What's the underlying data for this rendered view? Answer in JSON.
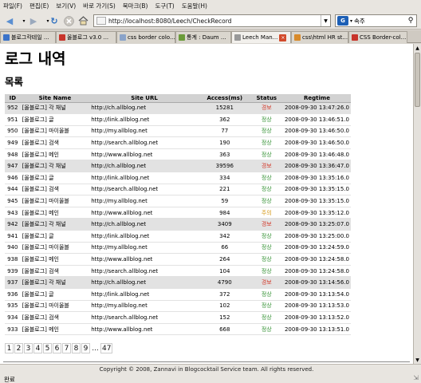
{
  "browser": {
    "menu": [
      "파일(F)",
      "편집(E)",
      "보기(V)",
      "바로 가기(S)",
      "북마크(B)",
      "도구(T)",
      "도움말(H)"
    ],
    "url": "http://localhost:8080/Leech/CheckRecord",
    "search_value": "속주",
    "status_text": "완료",
    "tabs": [
      {
        "label": "블로그칵테일 ...",
        "icon_color": "#3b73c9"
      },
      {
        "label": "올블로그 v3.0 ...",
        "icon_color": "#c8342b"
      },
      {
        "label": "css border colo...",
        "icon_color": "#8aa3c9"
      },
      {
        "label": "통계 : Daum ...",
        "icon_color": "#6a9b3a"
      },
      {
        "label": "Leech Man...",
        "icon_color": "#999999",
        "active": true
      },
      {
        "label": "css\\html HR st...",
        "icon_color": "#d88a2a"
      },
      {
        "label": "CSS Border-col...",
        "icon_color": "#c8342b"
      }
    ]
  },
  "page": {
    "title": "로그 내역",
    "section": "목록",
    "copyright": "Copyright © 2008, Zannavi in Blogcocktail Service team. All rights reserved."
  },
  "table": {
    "headers": [
      "ID",
      "Site Name",
      "Site URL",
      "Access(ms)",
      "Status",
      "Regtime"
    ],
    "rows": [
      {
        "id": "952",
        "name": "[올블로그] 각 채널",
        "url": "http://ch.allblog.net",
        "access": "15281",
        "status": "경보",
        "regtime": "2008-09-30 13:47:26.0"
      },
      {
        "id": "951",
        "name": "[올블로그] 글",
        "url": "http://link.allblog.net",
        "access": "362",
        "status": "정상",
        "regtime": "2008-09-30 13:46:51.0"
      },
      {
        "id": "950",
        "name": "[올블로그] 마이올블",
        "url": "http://my.allblog.net",
        "access": "77",
        "status": "정상",
        "regtime": "2008-09-30 13:46:50.0"
      },
      {
        "id": "949",
        "name": "[올블로그] 검색",
        "url": "http://search.allblog.net",
        "access": "190",
        "status": "정상",
        "regtime": "2008-09-30 13:46:50.0"
      },
      {
        "id": "948",
        "name": "[올블로그] 메인",
        "url": "http://www.allblog.net",
        "access": "363",
        "status": "정상",
        "regtime": "2008-09-30 13:46:48.0"
      },
      {
        "id": "947",
        "name": "[올블로그] 각 채널",
        "url": "http://ch.allblog.net",
        "access": "39596",
        "status": "경보",
        "regtime": "2008-09-30 13:36:47.0"
      },
      {
        "id": "946",
        "name": "[올블로그] 글",
        "url": "http://link.allblog.net",
        "access": "334",
        "status": "정상",
        "regtime": "2008-09-30 13:35:16.0"
      },
      {
        "id": "944",
        "name": "[올블로그] 검색",
        "url": "http://search.allblog.net",
        "access": "221",
        "status": "정상",
        "regtime": "2008-09-30 13:35:15.0"
      },
      {
        "id": "945",
        "name": "[올블로그] 마이올블",
        "url": "http://my.allblog.net",
        "access": "59",
        "status": "정상",
        "regtime": "2008-09-30 13:35:15.0"
      },
      {
        "id": "943",
        "name": "[올블로그] 메인",
        "url": "http://www.allblog.net",
        "access": "984",
        "status": "주의",
        "regtime": "2008-09-30 13:35:12.0"
      },
      {
        "id": "942",
        "name": "[올블로그] 각 채널",
        "url": "http://ch.allblog.net",
        "access": "3409",
        "status": "경보",
        "regtime": "2008-09-30 13:25:07.0"
      },
      {
        "id": "941",
        "name": "[올블로그] 글",
        "url": "http://link.allblog.net",
        "access": "342",
        "status": "정상",
        "regtime": "2008-09-30 13:25:00.0"
      },
      {
        "id": "940",
        "name": "[올블로그] 마이올블",
        "url": "http://my.allblog.net",
        "access": "66",
        "status": "정상",
        "regtime": "2008-09-30 13:24:59.0"
      },
      {
        "id": "938",
        "name": "[올블로그] 메인",
        "url": "http://www.allblog.net",
        "access": "264",
        "status": "정상",
        "regtime": "2008-09-30 13:24:58.0"
      },
      {
        "id": "939",
        "name": "[올블로그] 검색",
        "url": "http://search.allblog.net",
        "access": "104",
        "status": "정상",
        "regtime": "2008-09-30 13:24:58.0"
      },
      {
        "id": "937",
        "name": "[올블로그] 각 채널",
        "url": "http://ch.allblog.net",
        "access": "4790",
        "status": "경보",
        "regtime": "2008-09-30 13:14:56.0"
      },
      {
        "id": "936",
        "name": "[올블로그] 글",
        "url": "http://link.allblog.net",
        "access": "372",
        "status": "정상",
        "regtime": "2008-09-30 13:13:54.0"
      },
      {
        "id": "935",
        "name": "[올블로그] 마이올블",
        "url": "http://my.allblog.net",
        "access": "102",
        "status": "정상",
        "regtime": "2008-09-30 13:13:53.0"
      },
      {
        "id": "934",
        "name": "[올블로그] 검색",
        "url": "http://search.allblog.net",
        "access": "152",
        "status": "정상",
        "regtime": "2008-09-30 13:13:52.0"
      },
      {
        "id": "933",
        "name": "[올블로그] 메인",
        "url": "http://www.allblog.net",
        "access": "668",
        "status": "정상",
        "regtime": "2008-09-30 13:13:51.0"
      }
    ]
  },
  "pagination": [
    "1",
    "2",
    "3",
    "4",
    "5",
    "6",
    "7",
    "8",
    "9",
    "...",
    "47"
  ],
  "colors": {
    "ok": "#2f8f2f",
    "alarm": "#d23a2b",
    "caution": "#d69a18",
    "alt_row": "#e2e2e2"
  }
}
